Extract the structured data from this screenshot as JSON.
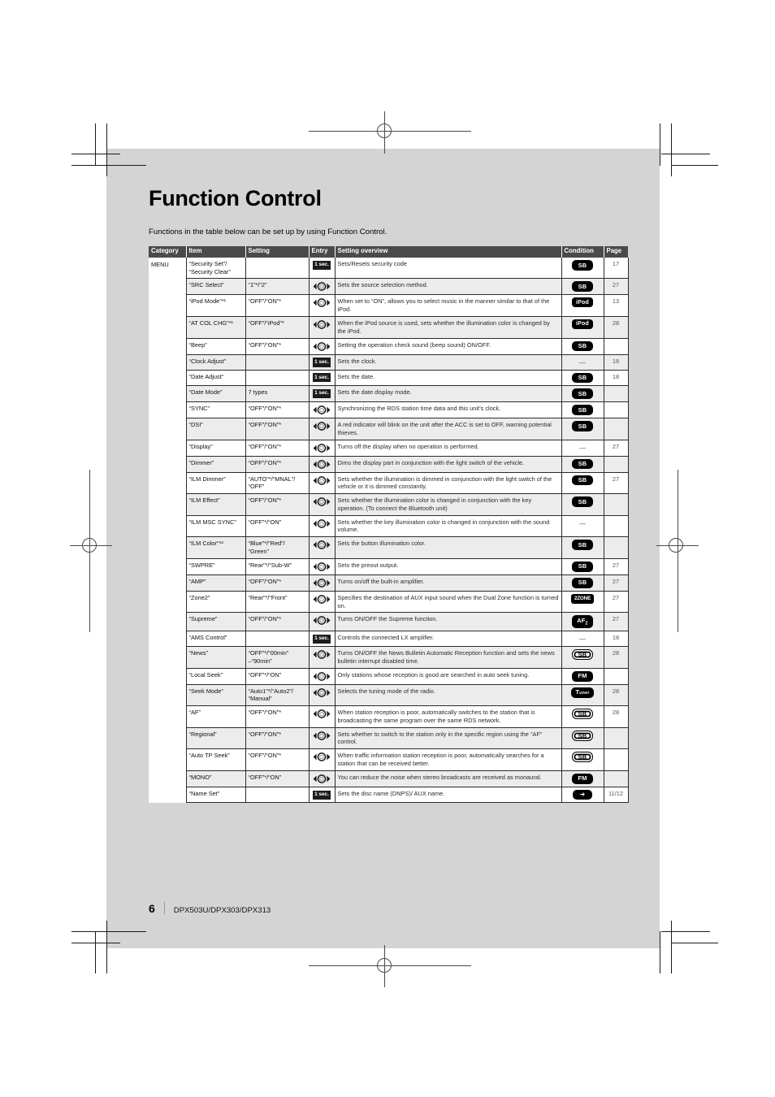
{
  "document": {
    "title": "Function Control",
    "intro": "Functions in the table below can be set up by using Function Control.",
    "footer_page_number": "6",
    "footer_models": "DPX503U/DPX303/DPX313"
  },
  "table": {
    "headers": {
      "category": "Category",
      "item": "Item",
      "setting": "Setting",
      "entry": "Entry",
      "overview": "Setting overview",
      "condition": "Condition",
      "page": "Page"
    },
    "category_label": "MENU",
    "entry_hold_label": "1 sec.",
    "rows": [
      {
        "item": "“Security Set”/\n“Security Clear”",
        "setting": "",
        "entry": "1sec",
        "overview": "Sets/Resets security code",
        "condition": "SB",
        "page": "17"
      },
      {
        "item": "“SRC Select”",
        "setting": "“1”*/“2”",
        "entry": "knob",
        "overview": "Sets the source selection method.",
        "condition": "SB",
        "page": "27"
      },
      {
        "item": "“iPod Mode”*¹",
        "setting": "“OFF”/“ON”*",
        "entry": "knob",
        "overview": "When set to “ON”, allows you to select music in the manner similar to that of the iPod.",
        "condition": "iPod",
        "page": "13"
      },
      {
        "item": "“AT COL CHG”*¹",
        "setting": "“OFF”/“iPod”*",
        "entry": "knob",
        "overview": "When the iPod source is used, sets whether the illumination color is changed by the iPod.",
        "condition": "iPod",
        "page": "28"
      },
      {
        "item": "“Beep”",
        "setting": "“OFF”/“ON”*",
        "entry": "knob",
        "overview": "Setting the operation check sound (beep sound) ON/OFF.",
        "condition": "SB",
        "page": ""
      },
      {
        "item": "“Clock Adjust”",
        "setting": "",
        "entry": "1sec",
        "overview": "Sets the clock.",
        "condition": "dash",
        "page": "18"
      },
      {
        "item": "“Date Adjust”",
        "setting": "",
        "entry": "1sec",
        "overview": "Sets the date.",
        "condition": "SB",
        "page": "18"
      },
      {
        "item": "“Date Mode”",
        "setting": "7 types",
        "entry": "1sec",
        "overview": "Sets the date display mode.",
        "condition": "SB",
        "page": ""
      },
      {
        "item": "“SYNC”",
        "setting": "“OFF”/“ON”*",
        "entry": "knob",
        "overview": "Synchronizing the RDS station time data and this unit’s clock.",
        "condition": "SB",
        "page": ""
      },
      {
        "item": "“DSI”",
        "setting": "“OFF”/“ON”*",
        "entry": "knob",
        "overview": "A red indicator will blink on the unit after the ACC is set to OFF, warning potential thieves.",
        "condition": "SB",
        "page": ""
      },
      {
        "item": "“Display”",
        "setting": "“OFF”/“ON”*",
        "entry": "knob",
        "overview": "Turns off the display when no operation is performed.",
        "condition": "dash",
        "page": "27"
      },
      {
        "item": "“Dimmer”",
        "setting": "“OFF”/“ON”*",
        "entry": "knob",
        "overview": "Dims the display part in conjunction with the light switch of the vehicle.",
        "condition": "SB",
        "page": ""
      },
      {
        "item": "“ILM Dimmer”",
        "setting": "“AUTO”*/“MNAL”/\n“OFF”",
        "entry": "knob",
        "overview": "Sets whether the illumination is dimmed in conjunction with the light switch of the vehicle or it is dimmed constantly.",
        "condition": "SB",
        "page": "27"
      },
      {
        "item": "“ILM Effect”",
        "setting": "“OFF”/“ON”*",
        "entry": "knob",
        "overview": "Sets whether the illumination color is changed in conjunction with the key operation. (To connect the Bluetooth unit)",
        "condition": "SB",
        "page": ""
      },
      {
        "item": "“ILM MSC SYNC”",
        "setting": "“OFF”*/“ON”",
        "entry": "knob",
        "overview": "Sets whether the key illumination color is changed in conjunction with the sound volume.",
        "condition": "dash",
        "page": ""
      },
      {
        "item": "“ILM Color”*²",
        "setting": "“Blue”*/“Red”/\n“Green”",
        "entry": "knob",
        "overview": "Sets the button illumination color.",
        "condition": "SB",
        "page": ""
      },
      {
        "item": "“SWPRE”",
        "setting": "“Rear”*/“Sub-W”",
        "entry": "knob",
        "overview": "Sets the preout output.",
        "condition": "SB",
        "page": "27"
      },
      {
        "item": "“AMP”",
        "setting": "“OFF”/“ON”*",
        "entry": "knob",
        "overview": "Turns on/off the built-in amplifier.",
        "condition": "SB",
        "page": "27"
      },
      {
        "item": "“Zone2”",
        "setting": "“Rear”*/“Front”",
        "entry": "knob",
        "overview": "Specifies the destination of AUX input sound when the Dual Zone function is turned on.",
        "condition": "2ZONE",
        "page": "27"
      },
      {
        "item": "“Supreme”",
        "setting": "“OFF”/“ON”*",
        "entry": "knob",
        "overview": "Turns ON/OFF the Supreme function.",
        "condition": "AF2",
        "page": "27"
      },
      {
        "item": "“AMS Control”",
        "setting": "",
        "entry": "1sec",
        "overview": "Controls the connected LX amplifier.",
        "condition": "dash",
        "page": "18"
      },
      {
        "item": "“News”",
        "setting": "“OFF”*/“00min”\n–“90min”",
        "entry": "knob",
        "overview": "Turns ON/OFF the News Bulletin Automatic Reception function and sets the news bulletin interrupt disabled time.",
        "condition": "SB-outline",
        "page": "28"
      },
      {
        "item": "“Local Seek”",
        "setting": "“OFF”*/“ON”",
        "entry": "knob",
        "overview": "Only stations whose reception is good are searched in auto seek tuning.",
        "condition": "FM",
        "page": ""
      },
      {
        "item": "“Seek Mode”",
        "setting": "“Auto1”*/“Auto2”/\n“Manual”",
        "entry": "knob",
        "overview": "Selects the tuning mode of the radio.",
        "condition": "Tuner",
        "page": "28"
      },
      {
        "item": "“AF”",
        "setting": "“OFF”/“ON”*",
        "entry": "knob",
        "overview": "When station reception is poor, automatically switches to the station that is broadcasting the same program over the same RDS network.",
        "condition": "SB-outline",
        "page": "28"
      },
      {
        "item": "“Regional”",
        "setting": "“OFF”/“ON”*",
        "entry": "knob",
        "overview": "Sets whether to switch to the station only in the specific region using the “AF” control.",
        "condition": "SB-outline",
        "page": ""
      },
      {
        "item": "“Auto TP Seek”",
        "setting": "“OFF”/“ON”*",
        "entry": "knob",
        "overview": "When traffic information station reception is poor, automatically searches for a station that can be received better.",
        "condition": "SB-outline",
        "page": ""
      },
      {
        "item": "“MONO”",
        "setting": "“OFF”*/“ON”",
        "entry": "knob",
        "overview": "You can reduce the noise when stereo broadcasts are received as monaural.",
        "condition": "FM",
        "page": ""
      },
      {
        "item": "“Name Set”",
        "setting": "",
        "entry": "1sec",
        "overview": "Sets the disc name (DNPS)/ AUX name.",
        "condition": "arrow",
        "page": "11/12"
      }
    ]
  },
  "badge_labels": {
    "SB": "SB",
    "SB-outline": "SB",
    "iPod": "iPod",
    "2ZONE": "2ZONE",
    "AF2": "AF",
    "AF2_sub": "2",
    "FM": "FM",
    "Tuner_main": "T",
    "Tuner_sub": "uner",
    "arrow": "➜",
    "dash": "—"
  },
  "colors": {
    "page_background": "#d4d4d4",
    "header_row": "#4a4a4a",
    "alt_row": "#ececec",
    "badge_background": "#000000",
    "text": "#111111"
  }
}
